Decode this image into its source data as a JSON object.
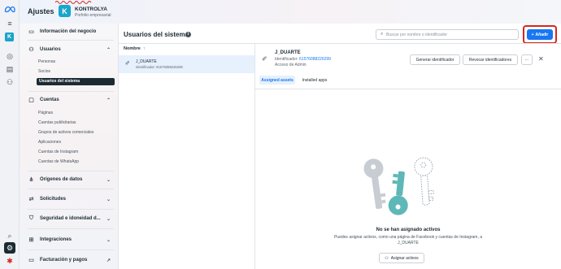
{
  "header": {
    "title": "Ajustes",
    "business_initial": "K",
    "business_name": "KONTROLYA",
    "business_subtitle": "Porfolio empresarial"
  },
  "rail": {
    "icons": [
      "meta-logo-icon",
      "menu-icon",
      "business-avatar-icon",
      "compass-icon",
      "list-icon",
      "people-icon",
      "search-icon",
      "settings-icon",
      "bug-icon"
    ],
    "avatar_initial": "K"
  },
  "sidebar": {
    "sections": [
      {
        "label": "Información del negocio",
        "icon": "info-icon"
      },
      {
        "label": "Usuarios",
        "icon": "users-icon",
        "expanded": true,
        "items": [
          "Personas",
          "Socios",
          "Usuarios del sistema"
        ],
        "active": "Usuarios del sistema"
      },
      {
        "label": "Cuentas",
        "icon": "accounts-icon",
        "expanded": true,
        "items": [
          "Páginas",
          "Cuentas publicitarias",
          "Grupos de activos comerciales",
          "Aplicaciones",
          "Cuentas de Instagram",
          "Cuentas de WhatsApp"
        ]
      },
      {
        "label": "Orígenes de datos",
        "icon": "data-sources-icon"
      },
      {
        "label": "Solicitudes",
        "icon": "requests-icon"
      },
      {
        "label": "Seguridad e idoneidad d...",
        "icon": "shield-icon"
      },
      {
        "label": "Integraciones",
        "icon": "integrations-icon"
      },
      {
        "label": "Facturación y pagos",
        "icon": "billing-icon"
      }
    ]
  },
  "main": {
    "title": "Usuarios del sistema",
    "search_placeholder": "Buscar por nombre o identificador",
    "add_label": "Añadir",
    "accent_color": "#1877f2",
    "highlight_color": "#d8261c",
    "list": {
      "header": "Nombre",
      "rows": [
        {
          "name": "J_DUARTE",
          "id_line": "Identificador: 61576088226208"
        }
      ]
    },
    "detail": {
      "name": "J_DUARTE",
      "id_label": "Identificador:",
      "id_value": "61576088226299",
      "access": "Acceso de Admin",
      "buttons": {
        "generate": "Generar identificador",
        "revoke": "Revocar identificadores",
        "more": "···",
        "close": "✕"
      },
      "tabs": [
        "Assigned assets",
        "Installed apps"
      ],
      "active_tab": "Assigned assets",
      "empty": {
        "title": "No se han asignado activos",
        "description": "Puedes asignar activos, como una página de Facebook y cuentas de Instagram, a J_DUARTE",
        "button": "Asignar activos"
      }
    }
  }
}
